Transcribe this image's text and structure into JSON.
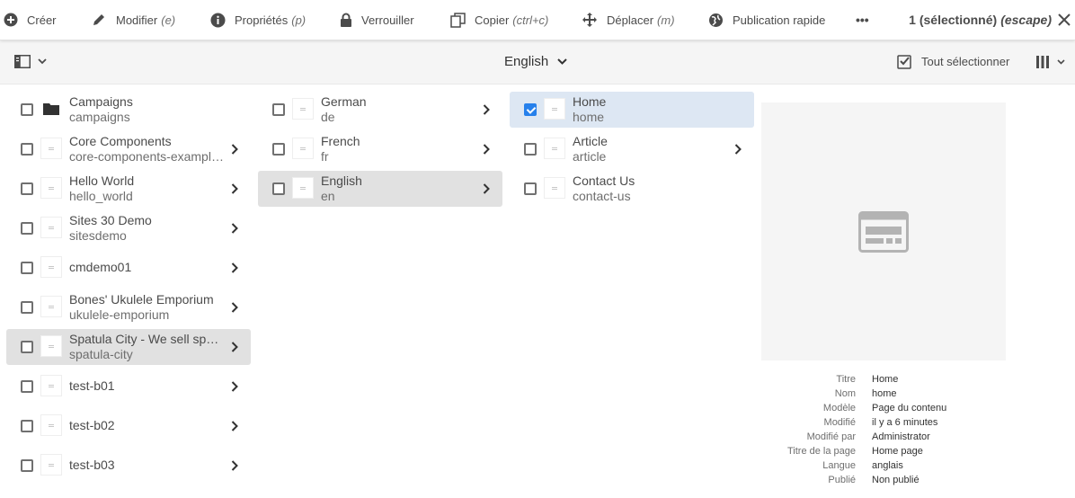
{
  "actionbar": {
    "create": {
      "label": "Créer",
      "shortcut": ""
    },
    "edit": {
      "label": "Modifier",
      "shortcut": "(e)"
    },
    "properties": {
      "label": "Propriétés",
      "shortcut": "(p)"
    },
    "lock": {
      "label": "Verrouiller",
      "shortcut": ""
    },
    "copy": {
      "label": "Copier",
      "shortcut": "(ctrl+c)"
    },
    "move": {
      "label": "Déplacer",
      "shortcut": "(m)"
    },
    "quick_publish": {
      "label": "Publication rapide",
      "shortcut": ""
    },
    "more": "•••",
    "selection": "1 (sélectionné)",
    "selection_escape": "(escape)"
  },
  "toolbar": {
    "title": "English",
    "select_all": "Tout sélectionner"
  },
  "columns": [
    {
      "items": [
        {
          "title": "Campaigns",
          "name": "campaigns",
          "icon": "folder-icon",
          "has_children": false
        },
        {
          "title": "Core Components",
          "name": "core-components-examples",
          "icon": "page-thumbnail",
          "has_children": true
        },
        {
          "title": "Hello World",
          "name": "hello_world",
          "icon": "page-thumbnail",
          "has_children": true
        },
        {
          "title": "Sites 30 Demo",
          "name": "sitesdemo",
          "icon": "page-thumbnail",
          "has_children": true
        },
        {
          "title": "cmdemo01",
          "name": "",
          "icon": "page-thumbnail",
          "has_children": true
        },
        {
          "title": "Bones' Ukulele Emporium",
          "name": "ukulele-emporium",
          "icon": "page-thumbnail",
          "has_children": true
        },
        {
          "title": "Spatula City - We sell spatulas...",
          "name": "spatula-city",
          "icon": "page-thumbnail",
          "has_children": true,
          "active": true
        },
        {
          "title": "test-b01",
          "name": "",
          "icon": "page-thumbnail",
          "has_children": true
        },
        {
          "title": "test-b02",
          "name": "",
          "icon": "page-thumbnail",
          "has_children": true
        },
        {
          "title": "test-b03",
          "name": "",
          "icon": "page-thumbnail",
          "has_children": true
        }
      ]
    },
    {
      "items": [
        {
          "title": "German",
          "name": "de",
          "icon": "page-thumbnail",
          "has_children": true
        },
        {
          "title": "French",
          "name": "fr",
          "icon": "page-thumbnail",
          "has_children": true
        },
        {
          "title": "English",
          "name": "en",
          "icon": "page-thumbnail",
          "has_children": true,
          "active": true
        }
      ]
    },
    {
      "items": [
        {
          "title": "Home",
          "name": "home",
          "icon": "page-thumbnail",
          "has_children": false,
          "checked": true
        },
        {
          "title": "Article",
          "name": "article",
          "icon": "page-thumbnail",
          "has_children": true
        },
        {
          "title": "Contact Us",
          "name": "contact-us",
          "icon": "page-thumbnail",
          "has_children": false
        }
      ]
    }
  ],
  "details": {
    "rows": [
      {
        "key": "Titre",
        "value": "Home"
      },
      {
        "key": "Nom",
        "value": "home"
      },
      {
        "key": "Modèle",
        "value": "Page du contenu"
      },
      {
        "key": "Modifié",
        "value": "il y a 6 minutes"
      },
      {
        "key": "Modifié par",
        "value": "Administrator"
      },
      {
        "key": "Titre de la page",
        "value": "Home page"
      },
      {
        "key": "Langue",
        "value": "anglais"
      },
      {
        "key": "Publié",
        "value": "Non publié"
      }
    ]
  },
  "colors": {
    "accent": "#2680eb",
    "selected_row": "#dde7f3",
    "active_row": "#e1e1e1"
  }
}
